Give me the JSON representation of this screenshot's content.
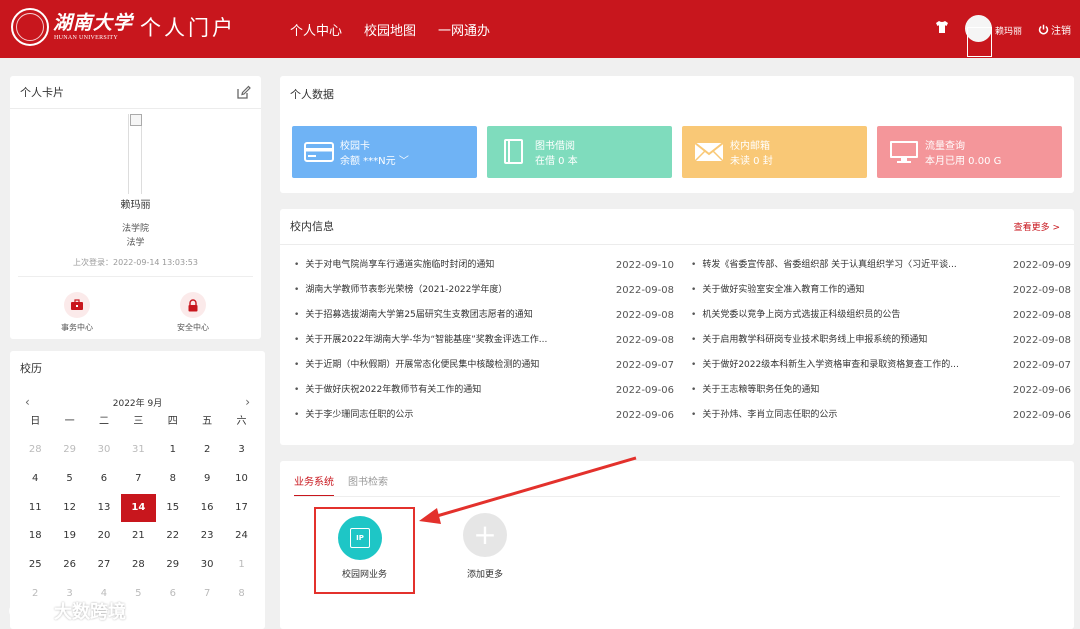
{
  "header": {
    "logo_name": "湖南大学",
    "logo_en": "HUNAN UNIVERSITY",
    "portal_title": "个人门户",
    "nav": [
      "个人中心",
      "校园地图",
      "一网通办"
    ],
    "user_name": "赖玛丽",
    "logout_label": "注销",
    "icons": [
      "shirt-icon",
      "power-icon"
    ],
    "colors": {
      "brand": "#c8161d"
    }
  },
  "card": {
    "title": "个人卡片",
    "name": "赖玛丽",
    "department": "法学院",
    "major": "法学",
    "last_login": "上次登录：2022-09-14 13:03:53",
    "quick": [
      {
        "label": "事务中心",
        "icon": "briefcase-icon"
      },
      {
        "label": "安全中心",
        "icon": "lock-icon"
      }
    ]
  },
  "calendar": {
    "title": "校历",
    "year_month": "2022年  9月",
    "prev": "‹",
    "next": "›",
    "weekdays": [
      "日",
      "一",
      "二",
      "三",
      "四",
      "五",
      "六"
    ],
    "days": [
      {
        "d": "28",
        "other": true
      },
      {
        "d": "29",
        "other": true
      },
      {
        "d": "30",
        "other": true
      },
      {
        "d": "31",
        "other": true
      },
      {
        "d": "1"
      },
      {
        "d": "2"
      },
      {
        "d": "3"
      },
      {
        "d": "4"
      },
      {
        "d": "5"
      },
      {
        "d": "6"
      },
      {
        "d": "7"
      },
      {
        "d": "8"
      },
      {
        "d": "9"
      },
      {
        "d": "10"
      },
      {
        "d": "11"
      },
      {
        "d": "12"
      },
      {
        "d": "13"
      },
      {
        "d": "14",
        "today": true
      },
      {
        "d": "15"
      },
      {
        "d": "16"
      },
      {
        "d": "17"
      },
      {
        "d": "18"
      },
      {
        "d": "19"
      },
      {
        "d": "20"
      },
      {
        "d": "21"
      },
      {
        "d": "22"
      },
      {
        "d": "23"
      },
      {
        "d": "24"
      },
      {
        "d": "25"
      },
      {
        "d": "26"
      },
      {
        "d": "27"
      },
      {
        "d": "28"
      },
      {
        "d": "29"
      },
      {
        "d": "30"
      },
      {
        "d": "1",
        "other": true
      },
      {
        "d": "2",
        "other": true
      },
      {
        "d": "3",
        "other": true
      },
      {
        "d": "4",
        "other": true
      },
      {
        "d": "5",
        "other": true
      },
      {
        "d": "6",
        "other": true
      },
      {
        "d": "7",
        "other": true
      },
      {
        "d": "8",
        "other": true
      }
    ]
  },
  "personal_data": {
    "title": "个人数据",
    "tiles": [
      {
        "name": "校园卡",
        "value": "余额 ***N元  ﹀",
        "color": "#6fb3f5",
        "icon": "card-icon"
      },
      {
        "name": "图书借阅",
        "value": "在借 0 本",
        "color": "#7fdcbd",
        "icon": "book-icon"
      },
      {
        "name": "校内邮箱",
        "value": "未读 0 封",
        "color": "#f9c876",
        "icon": "mail-icon"
      },
      {
        "name": "流量查询",
        "value": "本月已用 0.00 G",
        "color": "#f4969a",
        "icon": "monitor-icon"
      }
    ]
  },
  "news": {
    "title": "校内信息",
    "more_label": "查看更多 >",
    "left": [
      {
        "title": "关于对电气院尚享车行通道实施临时封闭的通知",
        "date": "2022-09-10"
      },
      {
        "title": "湖南大学教师节表彰光荣榜（2021-2022学年度）",
        "date": "2022-09-08"
      },
      {
        "title": "关于招募选拔湖南大学第25届研究生支教团志愿者的通知",
        "date": "2022-09-08"
      },
      {
        "title": "关于开展2022年湖南大学-华为“智能基座”奖教金评选工作...",
        "date": "2022-09-08"
      },
      {
        "title": "关于近期（中秋假期）开展常态化便民集中核酸检测的通知",
        "date": "2022-09-07"
      },
      {
        "title": "关于做好庆祝2022年教师节有关工作的通知",
        "date": "2022-09-06"
      },
      {
        "title": "关于李少珊同志任职的公示",
        "date": "2022-09-06"
      }
    ],
    "right": [
      {
        "title": "转发《省委宣传部、省委组织部 关于认真组织学习〈习近平谈...",
        "date": "2022-09-09"
      },
      {
        "title": "关于做好实验室安全准入教育工作的通知",
        "date": "2022-09-08"
      },
      {
        "title": "机关党委以竞争上岗方式选拔正科级组织员的公告",
        "date": "2022-09-08"
      },
      {
        "title": "关于启用教学科研岗专业技术职务线上申报系统的预通知",
        "date": "2022-09-08"
      },
      {
        "title": "关于做好2022级本科新生入学资格审查和录取资格复查工作的...",
        "date": "2022-09-07"
      },
      {
        "title": "关于王志粮等职务任免的通知",
        "date": "2022-09-06"
      },
      {
        "title": "关于孙炜、李肖立同志任职的公示",
        "date": "2022-09-06"
      }
    ]
  },
  "business": {
    "tabs": [
      {
        "label": "业务系统",
        "active": true
      },
      {
        "label": "图书检索",
        "active": false
      }
    ],
    "app": {
      "label": "校园网业务",
      "icon_text": "IP",
      "icon": "ip-icon"
    },
    "add": {
      "label": "添加更多",
      "icon": "plus-icon"
    }
  },
  "watermark": {
    "text": "大数跨境"
  }
}
